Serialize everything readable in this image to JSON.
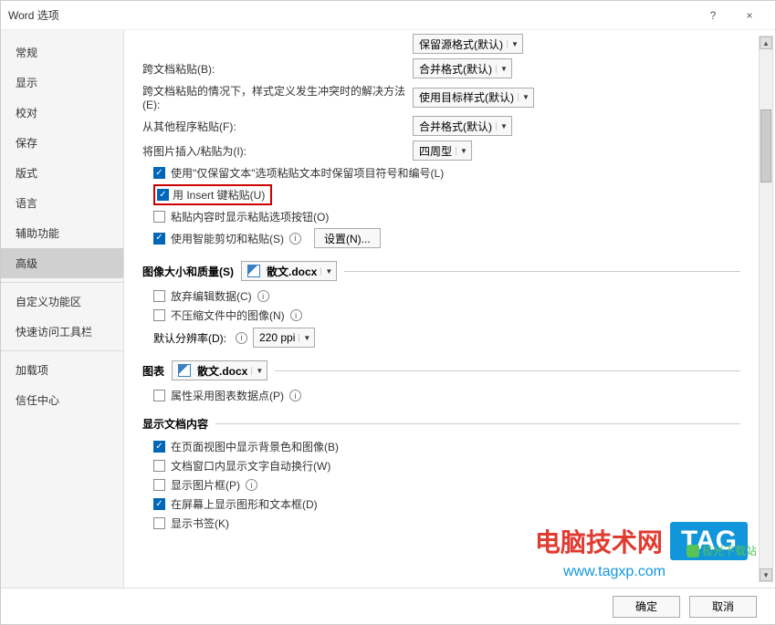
{
  "window": {
    "title": "Word 选项",
    "help_tooltip": "?",
    "close_tooltip": "×"
  },
  "sidebar": {
    "items": [
      {
        "label": "常规",
        "active": false
      },
      {
        "label": "显示",
        "active": false
      },
      {
        "label": "校对",
        "active": false
      },
      {
        "label": "保存",
        "active": false
      },
      {
        "label": "版式",
        "active": false
      },
      {
        "label": "语言",
        "active": false
      },
      {
        "label": "辅助功能",
        "active": false
      },
      {
        "label": "高级",
        "active": true
      },
      {
        "label": "自定义功能区",
        "active": false
      },
      {
        "label": "快速访问工具栏",
        "active": false
      },
      {
        "label": "加载项",
        "active": false
      },
      {
        "label": "信任中心",
        "active": false
      }
    ]
  },
  "paste": {
    "top_dd_value": "保留源格式(默认)",
    "cross_doc_label": "跨文档粘贴(B):",
    "cross_doc_value": "合并格式(默认)",
    "conflict_label": "跨文档粘贴的情况下，样式定义发生冲突时的解决方法(E):",
    "conflict_value": "使用目标样式(默认)",
    "other_prog_label": "从其他程序粘贴(F):",
    "other_prog_value": "合并格式(默认)",
    "insert_pic_label": "将图片插入/粘贴为(I):",
    "insert_pic_value": "四周型",
    "chk_keep_text": "使用\"仅保留文本\"选项粘贴文本时保留项目符号和编号(L)",
    "chk_insert_key": "用 Insert 键粘贴(U)",
    "chk_paste_btn": "粘贴内容时显示粘贴选项按钮(O)",
    "chk_smart_paste": "使用智能剪切和粘贴(S)",
    "settings_btn": "设置(N)..."
  },
  "image_quality": {
    "header": "图像大小和质量(S)",
    "doc_name": "散文.docx",
    "chk_discard": "放弃编辑数据(C)",
    "chk_nocompress": "不压缩文件中的图像(N)",
    "default_res_label": "默认分辨率(D):",
    "default_res_value": "220 ppi"
  },
  "chart": {
    "header": "图表",
    "doc_name": "散文.docx",
    "chk_props": "属性采用图表数据点(P)"
  },
  "display_content": {
    "header": "显示文档内容",
    "chk_bg": "在页面视图中显示背景色和图像(B)",
    "chk_wrap": "文档窗口内显示文字自动换行(W)",
    "chk_picframe": "显示图片框(P)",
    "chk_drawings": "在屏幕上显示图形和文本框(D)",
    "chk_bookmark": "显示书签(K)"
  },
  "footer": {
    "ok": "确定",
    "cancel": "取消"
  },
  "watermark": {
    "text": "电脑技术网",
    "tag": "TAG",
    "url": "www.tagxp.com",
    "small": "极光下载站"
  }
}
